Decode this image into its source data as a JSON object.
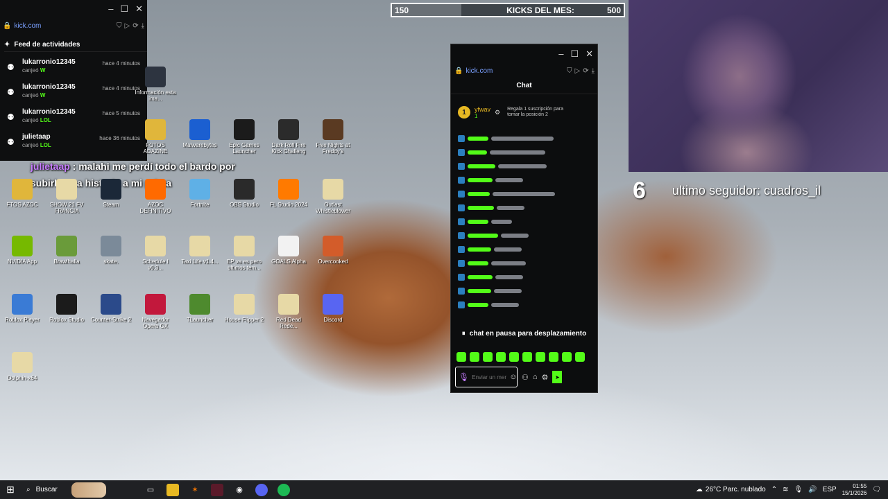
{
  "feed": {
    "url": "kick.com",
    "title": "Feed de actividades",
    "items": [
      {
        "user": "lukarronio12345",
        "action": "canjeó",
        "reward": "W",
        "time": "hace 4 minutos"
      },
      {
        "user": "lukarronio12345",
        "action": "canjeó",
        "reward": "W",
        "time": "hace 4 minutos"
      },
      {
        "user": "lukarronio12345",
        "action": "canjeó",
        "reward": "LOL",
        "time": "hace 5 minutos"
      },
      {
        "user": "julietaap",
        "action": "canjeó",
        "reward": "LOL",
        "time": "hace 36 minutos"
      }
    ]
  },
  "alert": {
    "user": "julietaap",
    "message": " : malahi me perdí todo el bardo por subirle una historia a mi prima"
  },
  "goal": {
    "current": "150",
    "title": "KICKS DEL MES:",
    "target": "500",
    "progress": 0.3
  },
  "follower": {
    "count": "6",
    "text": "ultimo seguidor: cuadros_il"
  },
  "chat": {
    "url": "kick.com",
    "title": "Chat",
    "pinned_user": "yfwav",
    "pinned_count": "1",
    "pinned_note": "Regala 1 suscripción para tomar la posición 2",
    "paused": "chat en pausa para desplazamiento",
    "input_placeholder": "Enviar un mensaje"
  },
  "desktop_icons": [
    {
      "label": "Información esta ima...",
      "icon": "info-icon",
      "color": "#2d3440"
    },
    {
      "label": "FOTOS ADAZINE",
      "icon": "folder-icon",
      "color": "#e0b63b"
    },
    {
      "label": "Malwarebytes",
      "icon": "malwarebytes-icon",
      "color": "#1b5fd1"
    },
    {
      "label": "Epic Games Launcher",
      "icon": "epic-icon",
      "color": "#1b1b1b"
    },
    {
      "label": "Dark Roll Fire Kick Challeng",
      "icon": "ball-icon",
      "color": "#2b2b2b"
    },
    {
      "label": "Five Nights at Freddy's",
      "icon": "fnaf-icon",
      "color": "#5a3a22"
    },
    {
      "label": "FTOS AZOC",
      "icon": "folder-icon",
      "color": "#e0b63b"
    },
    {
      "label": "SHOW 21 FV FRANCIA",
      "icon": "file-icon",
      "color": "#e7d9a6"
    },
    {
      "label": "Steam",
      "icon": "steam-icon",
      "color": "#1b2838"
    },
    {
      "label": "AZOC DEFINITIVO",
      "icon": "fl-icon",
      "color": "#ff6a00"
    },
    {
      "label": "Fortnite",
      "icon": "fortnite-icon",
      "color": "#5fb0e6"
    },
    {
      "label": "OBS Studio",
      "icon": "obs-icon",
      "color": "#2a2a2a"
    },
    {
      "label": "FL Studio 2024",
      "icon": "fl-studio-icon",
      "color": "#ff7a00"
    },
    {
      "label": "Outlast Whistleblower",
      "icon": "file-icon",
      "color": "#e7d9a6"
    },
    {
      "label": "NVIDIA App",
      "icon": "nvidia-icon",
      "color": "#76b900"
    },
    {
      "label": "Brawlhalla",
      "icon": "brawlhalla-icon",
      "color": "#6a9b3a"
    },
    {
      "label": "skate.",
      "icon": "skate-icon",
      "color": "#7b8a99"
    },
    {
      "label": "Schedule I v0.3...",
      "icon": "file-icon",
      "color": "#e7d9a6"
    },
    {
      "label": "Taxi Life v1.4...",
      "icon": "file-icon",
      "color": "#e7d9a6"
    },
    {
      "label": "EP va es pero ultimos tem...",
      "icon": "file-icon",
      "color": "#e7d9a6"
    },
    {
      "label": "GOALS Alpha",
      "icon": "goals-icon",
      "color": "#f2f2f2"
    },
    {
      "label": "Overcooked",
      "icon": "overcooked-icon",
      "color": "#d35c2a"
    },
    {
      "label": "Roblox Player",
      "icon": "roblox-icon",
      "color": "#3a7bd5"
    },
    {
      "label": "Roblox Studio",
      "icon": "roblox-studio-icon",
      "color": "#1b1b1b"
    },
    {
      "label": "Counter-Strike 2",
      "icon": "cs2-icon",
      "color": "#2b4a8a"
    },
    {
      "label": "Navegador Opera GX",
      "icon": "opera-icon",
      "color": "#c2183c"
    },
    {
      "label": "TLauncher",
      "icon": "tlauncher-icon",
      "color": "#4e8a2e"
    },
    {
      "label": "House Flipper 2",
      "icon": "file-icon",
      "color": "#e7d9a6"
    },
    {
      "label": "Red Dead Rede...",
      "icon": "file-icon",
      "color": "#e7d9a6"
    },
    {
      "label": "Discord",
      "icon": "discord-icon",
      "color": "#5865f2"
    },
    {
      "label": "Dolphin-x64",
      "icon": "file-icon",
      "color": "#e7d9a6"
    }
  ],
  "taskbar": {
    "search": "Buscar",
    "weather": "26°C  Parc. nublado",
    "lang": "ESP",
    "time": "01:55",
    "date": "15/1/2026"
  }
}
